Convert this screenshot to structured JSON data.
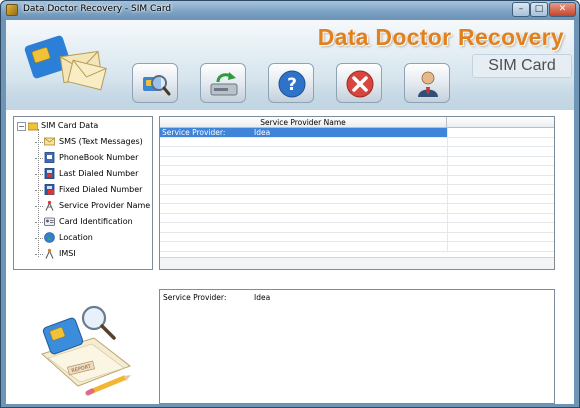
{
  "window": {
    "title": "Data Doctor Recovery - SIM Card",
    "controls": {
      "minimize": "–",
      "maximize": "□",
      "close": "✕"
    }
  },
  "header": {
    "brand_title": "Data Doctor Recovery",
    "brand_subtitle": "SIM Card"
  },
  "toolbar": [
    {
      "name": "search-button",
      "icon": "search-sim-icon"
    },
    {
      "name": "save-button",
      "icon": "save-drive-icon"
    },
    {
      "name": "help-button",
      "icon": "help-icon"
    },
    {
      "name": "exit-button",
      "icon": "close-icon"
    },
    {
      "name": "about-button",
      "icon": "user-icon"
    }
  ],
  "tree": {
    "root": "SIM Card Data",
    "items": [
      {
        "label": "SMS (Text Messages)",
        "icon": "envelope-icon"
      },
      {
        "label": "PhoneBook Number",
        "icon": "phonebook-icon"
      },
      {
        "label": "Last Dialed Number",
        "icon": "phone-icon"
      },
      {
        "label": "Fixed Dialed Number",
        "icon": "phone-fixed-icon"
      },
      {
        "label": "Service Provider Name",
        "icon": "antenna-icon"
      },
      {
        "label": "Card Identification",
        "icon": "id-card-icon"
      },
      {
        "label": "Location",
        "icon": "globe-icon"
      },
      {
        "label": "IMSI",
        "icon": "sim-icon"
      }
    ]
  },
  "grid": {
    "column_header": "Service Provider Name",
    "rows": [
      {
        "label": "Service Provider:",
        "value": "Idea",
        "selected": true
      }
    ]
  },
  "detail": {
    "label": "Service Provider:",
    "value": "Idea"
  },
  "colors": {
    "brand_orange": "#e2801e",
    "selection_blue": "#3f84d8",
    "frame_blue": "#6f95b6"
  }
}
